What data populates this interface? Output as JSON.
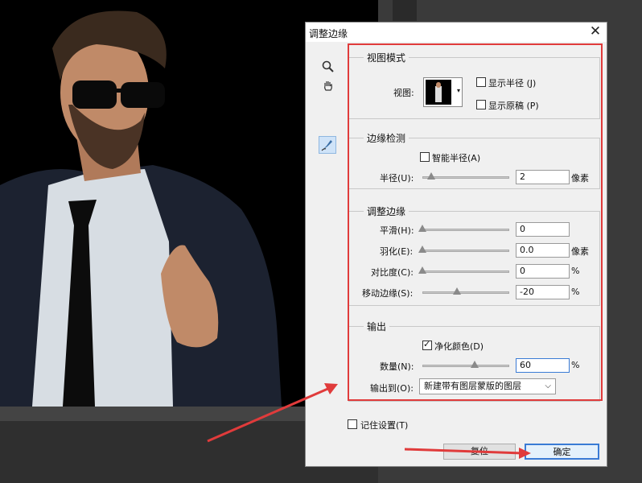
{
  "dialog": {
    "title": "调整边缘",
    "close_glyph": "✕"
  },
  "view_mode": {
    "title": "视图模式",
    "view_label": "视图:",
    "show_radius": {
      "label": "显示半径 (J)",
      "checked": false
    },
    "show_original": {
      "label": "显示原稿 (P)",
      "checked": false
    }
  },
  "edge_detection": {
    "title": "边缘检测",
    "smart_radius": {
      "label": "智能半径(A)",
      "checked": false
    },
    "radius": {
      "label": "半径(U):",
      "value": "2",
      "unit": "像素",
      "slider_fraction": 0.1
    }
  },
  "adjust_edge": {
    "title": "调整边缘",
    "smooth": {
      "label": "平滑(H):",
      "value": "0",
      "unit": "",
      "slider_fraction": 0.0
    },
    "feather": {
      "label": "羽化(E):",
      "value": "0.0",
      "unit": "像素",
      "slider_fraction": 0.0
    },
    "contrast": {
      "label": "对比度(C):",
      "value": "0",
      "unit": "%",
      "slider_fraction": 0.0
    },
    "shift_edge": {
      "label": "移动边缘(S):",
      "value": "-20",
      "unit": "%",
      "slider_fraction": 0.4
    }
  },
  "output": {
    "title": "输出",
    "decontaminate": {
      "label": "净化颜色(D)",
      "checked": true
    },
    "amount": {
      "label": "数量(N):",
      "value": "60",
      "unit": "%",
      "slider_fraction": 0.6
    },
    "output_to_label": "输出到(O):",
    "output_to_value": "新建带有图层蒙版的图层"
  },
  "remember": {
    "label": "记住设置(T)",
    "checked": false
  },
  "buttons": {
    "reset": "复位",
    "ok": "确定"
  },
  "colors": {
    "annotation_red": "#e03b3b",
    "focus_blue": "#3a7bd5"
  },
  "icons": [
    "zoom-icon",
    "hand-icon",
    "refine-radius-brush-icon",
    "dropdown-arrow-icon",
    "close-icon"
  ]
}
